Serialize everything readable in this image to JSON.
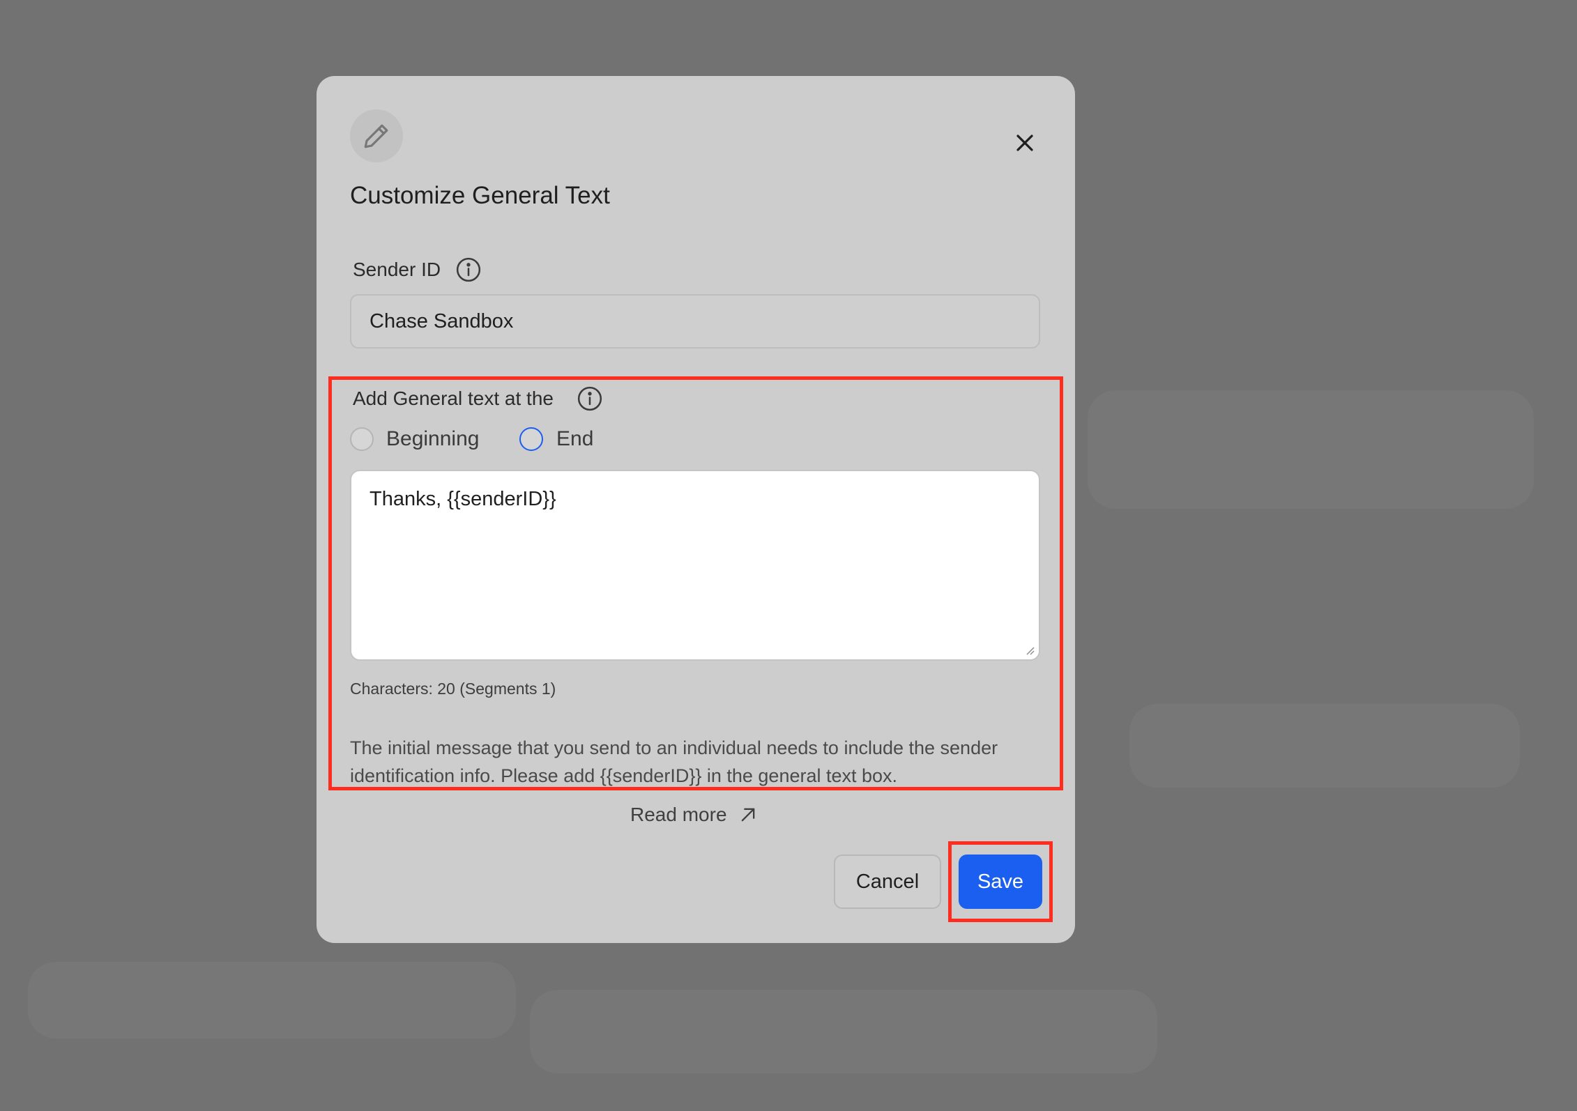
{
  "dialog": {
    "title": "Customize General Text",
    "icon": "pencil-icon",
    "close_icon": "close-icon"
  },
  "sender": {
    "label": "Sender ID",
    "value": "Chase Sandbox"
  },
  "position": {
    "label": "Add General text at the",
    "options": [
      {
        "label": "Beginning",
        "selected": false
      },
      {
        "label": "End",
        "selected": true
      }
    ]
  },
  "general_text": {
    "value": "Thanks, {{senderID}}",
    "char_count": "Characters: 20 (Segments 1)"
  },
  "helper": {
    "text": "The initial message that you send to an individual needs to include the sender identification info. Please add {{senderID}} in the general text box.",
    "read_more": "Read more"
  },
  "buttons": {
    "cancel": "Cancel",
    "save": "Save"
  },
  "colors": {
    "accent": "#1a5ff0",
    "highlight": "#ff2d20",
    "backdrop": "#727272",
    "dialog_bg": "#cdcdcd"
  }
}
